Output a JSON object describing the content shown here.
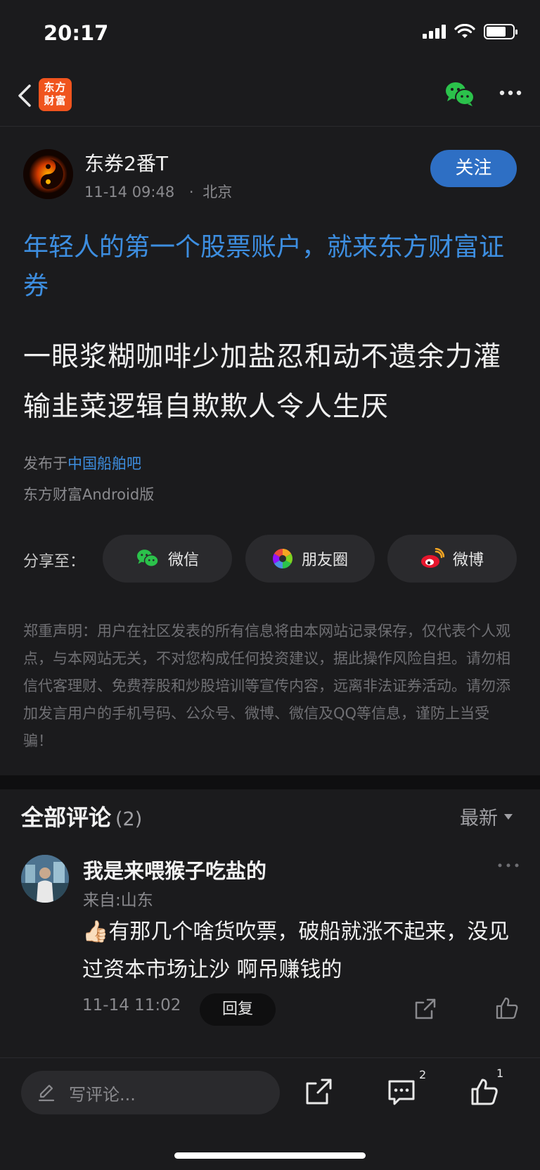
{
  "status": {
    "time": "20:17"
  },
  "nav": {
    "logo_text": "东方财富",
    "logo_color": "#f0541e"
  },
  "author": {
    "name": "东券2番T",
    "date": "11-14 09:48",
    "separator": "·",
    "location": "北京",
    "follow_label": "关注"
  },
  "post": {
    "promo": "年轻人的第一个股票账户，就来东方财富证券",
    "body": "一眼浆糊咖啡少加盐忍和动不遗余力灌输韭菜逻辑自欺欺人令人生厌",
    "published_prefix": "发布于",
    "forum": "中国船舶吧",
    "client": "东方财富Android版"
  },
  "share": {
    "label": "分享至：",
    "targets": [
      {
        "label": "微信",
        "icon": "wechat-icon"
      },
      {
        "label": "朋友圈",
        "icon": "moments-icon"
      },
      {
        "label": "微博",
        "icon": "weibo-icon"
      }
    ]
  },
  "disclaimer": "郑重声明：用户在社区发表的所有信息将由本网站记录保存，仅代表个人观点，与本网站无关，不对您构成任何投资建议，据此操作风险自担。请勿相信代客理财、免费荐股和炒股培训等宣传内容，远离非法证券活动。请勿添加发言用户的手机号码、公众号、微博、微信及QQ等信息，谨防上当受骗！",
  "comments": {
    "title": "全部评论",
    "count": "(2)",
    "sort": "最新",
    "items": [
      {
        "name": "我是来喂猴子吃盐的",
        "location": "来自:山东",
        "emoji": "👍🏻",
        "text": "有那几个啥货吹票，破船就涨不起来，没见过资本市场让沙  啊吊赚钱的",
        "time": "11-14 11:02",
        "reply_label": "回复"
      }
    ]
  },
  "bottom": {
    "input_placeholder": "写评论...",
    "comment_count": "2",
    "like_count": "1"
  },
  "colors": {
    "accent": "#2e6fc4",
    "link": "#3d8ee0",
    "background": "#1b1b1d"
  }
}
